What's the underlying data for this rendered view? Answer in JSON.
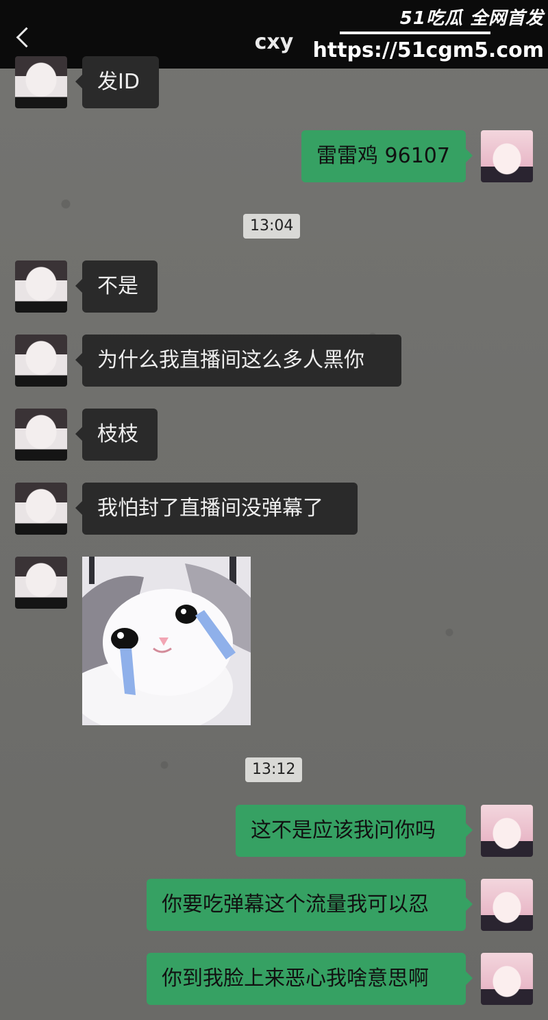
{
  "header": {
    "title": "cxy"
  },
  "watermark": {
    "logo": "51吃瓜 全网首发",
    "url": "https://51cgm5.com"
  },
  "messages": [
    {
      "side": "left",
      "text": "发ID"
    },
    {
      "side": "right",
      "text": "雷雷鸡 96107"
    },
    {
      "timestamp": "13:04"
    },
    {
      "side": "left",
      "text": "不是"
    },
    {
      "side": "left",
      "text": "为什么我直播间这么多人黑你"
    },
    {
      "side": "left",
      "text": "枝枝"
    },
    {
      "side": "left",
      "text": "我怕封了直播间没弹幕了"
    },
    {
      "side": "left",
      "sticker": "crying-cat-sticker"
    },
    {
      "timestamp": "13:12"
    },
    {
      "side": "right",
      "text": "这不是应该我问你吗"
    },
    {
      "side": "right",
      "text": "你要吃弹幕这个流量我可以忍"
    },
    {
      "side": "right",
      "text": "你到我脸上来恶心我啥意思啊"
    }
  ],
  "icons": {
    "back": "chevron-left-icon"
  }
}
